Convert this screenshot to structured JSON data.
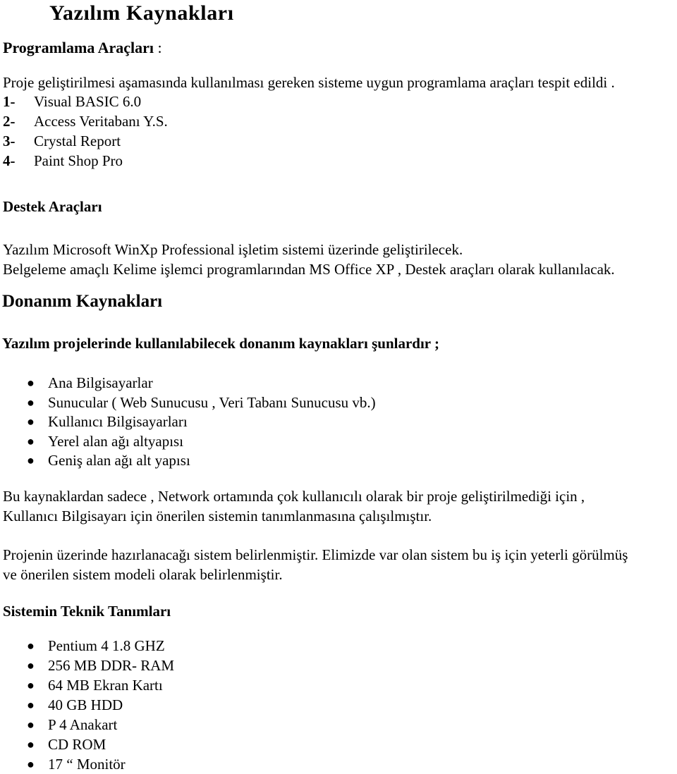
{
  "document": {
    "title": "Yazılım Kaynakları",
    "programming_tools": {
      "heading": "Programlama Araçları",
      "heading_colon": " :",
      "intro": "Proje geliştirilmesi aşamasında kullanılması gereken sisteme uygun programlama araçları tespit edildi .",
      "items": [
        {
          "number": "1-",
          "label": "Visual BASIC 6.0"
        },
        {
          "number": "2-",
          "label": "Access Veritabanı Y.S."
        },
        {
          "number": "3-",
          "label": "Crystal Report"
        },
        {
          "number": "4-",
          "label": "Paint Shop Pro"
        }
      ]
    },
    "support_tools": {
      "heading": "Destek Araçları",
      "line1": "Yazılım Microsoft WinXp Professional işletim sistemi üzerinde geliştirilecek.",
      "line2": "Belgeleme amaçlı Kelime işlemci programlarından  MS Office XP , Destek araçları olarak kullanılacak."
    },
    "hardware_resources": {
      "heading": "Donanım Kaynakları",
      "lead": "Yazılım projelerinde kullanılabilecek donanım kaynakları şunlardır ;",
      "bullet_glyph": "●",
      "items": [
        "Ana Bilgisayarlar",
        "Sunucular ( Web Sunucusu , Veri Tabanı Sunucusu vb.)",
        "Kullanıcı Bilgisayarları",
        "Yerel alan ağı altyapısı",
        "Geniş alan ağı alt yapısı"
      ]
    },
    "network_note": {
      "line1": "Bu kaynaklardan sadece , Network ortamında çok kullanıcılı olarak bir proje geliştirilmediği için ,",
      "line2": "Kullanıcı Bilgisayarı için önerilen sistemin tanımlanmasına çalışılmıştır."
    },
    "project_note": {
      "line1": "Projenin üzerinde hazırlanacağı sistem belirlenmiştir. Elimizde var olan sistem bu iş için yeterli görülmüş",
      "line2": "ve önerilen sistem modeli olarak belirlenmiştir."
    },
    "technical_specs": {
      "heading": "Sistemin Teknik Tanımları",
      "bullet_glyph": "●",
      "items": [
        "Pentium 4  1.8 GHZ",
        "256 MB DDR- RAM",
        "64 MB Ekran Kartı",
        "40 GB HDD",
        "P 4 Anakart",
        "CD ROM",
        "17 “ Monitör"
      ]
    }
  }
}
